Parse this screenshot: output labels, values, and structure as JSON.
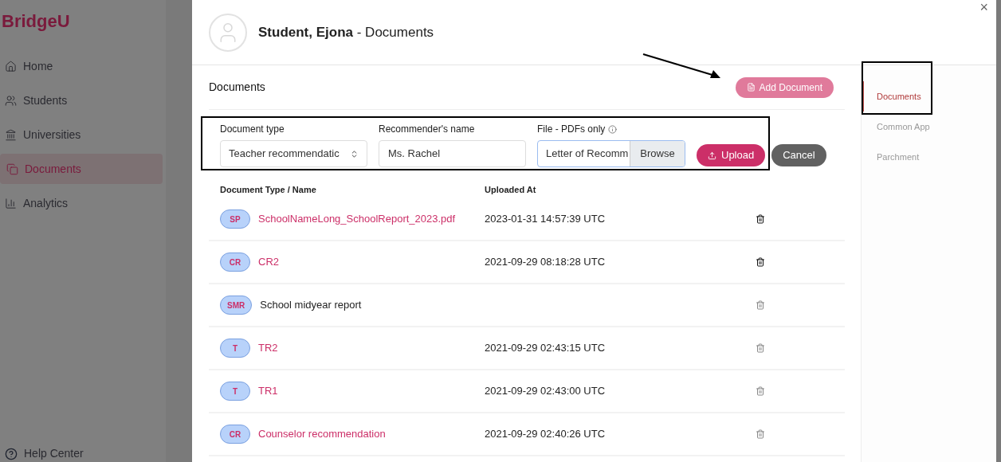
{
  "app_sidebar": {
    "logo": "BridgeU",
    "items": [
      {
        "label": "Home",
        "kind": "home",
        "selected": false
      },
      {
        "label": "Students",
        "kind": "users",
        "selected": false
      },
      {
        "label": "Universities",
        "kind": "bank",
        "selected": false
      },
      {
        "label": "Documents",
        "kind": "docs",
        "selected": true
      },
      {
        "label": "Analytics",
        "kind": "chart",
        "selected": false
      }
    ],
    "help": "Help Center"
  },
  "modal": {
    "student_name": "Student, Ejona",
    "title_suffix": "- Documents",
    "close": "×",
    "section_title": "Documents",
    "add_button": "Add Document",
    "form": {
      "document_type": {
        "label": "Document type",
        "value": "Teacher recommendatic"
      },
      "recommender": {
        "label": "Recommender's name",
        "value": "Ms. Rachel"
      },
      "file": {
        "label": "File - PDFs only",
        "value": "Letter of Recomm",
        "browse": "Browse"
      },
      "upload": "Upload",
      "cancel": "Cancel"
    },
    "table": {
      "columns": [
        "Document Type / Name",
        "Uploaded At"
      ],
      "rows": [
        {
          "badge": "SP",
          "name": "SchoolNameLong_SchoolReport_2023.pdf",
          "kind": "link",
          "uploaded": "2023-01-31 14:57:39 UTC",
          "delete_enabled": true
        },
        {
          "badge": "CR",
          "name": "CR2",
          "kind": "link",
          "uploaded": "2021-09-29 08:18:28 UTC",
          "delete_enabled": true
        },
        {
          "badge": "SMR",
          "name": "School midyear report",
          "kind": "text",
          "delete_enabled": false
        },
        {
          "badge": "T",
          "name": "TR2",
          "kind": "link",
          "uploaded": "2021-09-29 02:43:15 UTC",
          "delete_enabled": false
        },
        {
          "badge": "T",
          "name": "TR1",
          "kind": "link",
          "uploaded": "2021-09-29 02:43:00 UTC",
          "delete_enabled": false
        },
        {
          "badge": "CR",
          "name": "Counselor recommendation",
          "kind": "link",
          "uploaded": "2021-09-29 02:40:26 UTC",
          "delete_enabled": false
        }
      ]
    },
    "side_tabs": [
      {
        "label": "Documents",
        "selected": true
      },
      {
        "label": "Common App",
        "selected": false
      },
      {
        "label": "Parchment",
        "selected": false
      }
    ]
  }
}
